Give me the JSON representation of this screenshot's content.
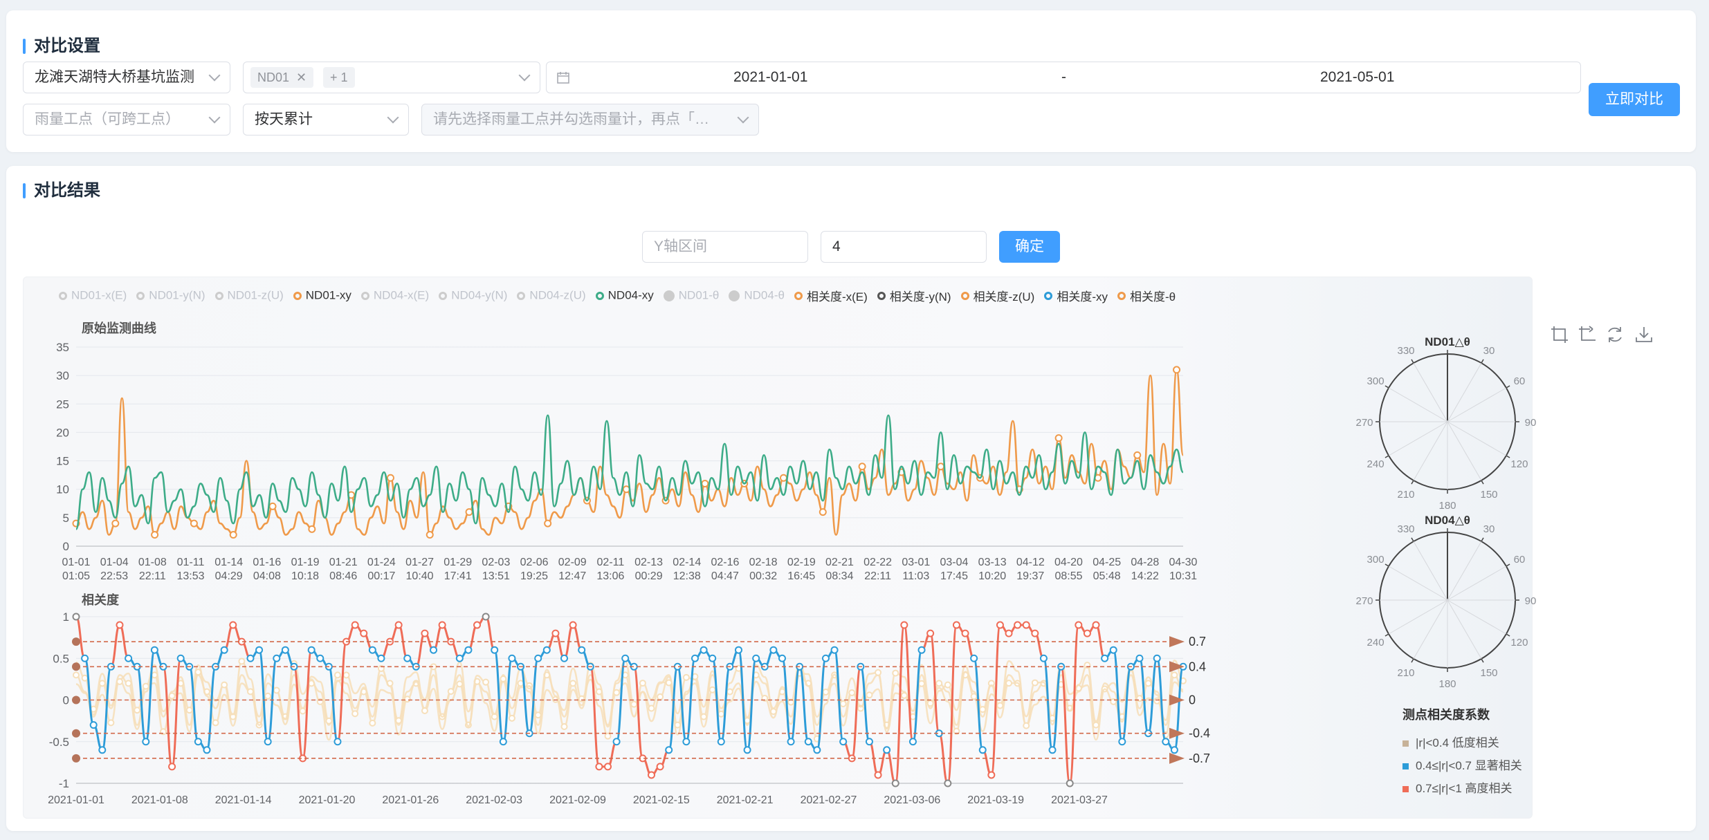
{
  "settings": {
    "title": "对比设置",
    "project": "龙滩天湖特大桥基坑监测",
    "point_tag": "ND01",
    "point_more": "+ 1",
    "date_start": "2021-01-01",
    "date_sep": "-",
    "date_end": "2021-05-01",
    "rain_placeholder": "雨量工点（可跨工点）",
    "accum": "按天累计",
    "rain_gauge_placeholder": "请先选择雨量工点并勾选雨量计，再点「…",
    "compare_button": "立即对比"
  },
  "results": {
    "title": "对比结果",
    "y_range_placeholder": "Y轴区间",
    "y_range_value": "4",
    "confirm_button": "确定"
  },
  "legend": [
    {
      "label": "ND01-x(E)",
      "color": "#cccccc",
      "kind": "ring",
      "active": false
    },
    {
      "label": "ND01-y(N)",
      "color": "#cccccc",
      "kind": "ring",
      "active": false
    },
    {
      "label": "ND01-z(U)",
      "color": "#cccccc",
      "kind": "ring",
      "active": false
    },
    {
      "label": "ND01-xy",
      "color": "#ef9a4a",
      "kind": "ring",
      "active": true
    },
    {
      "label": "ND04-x(E)",
      "color": "#cccccc",
      "kind": "ring",
      "active": false
    },
    {
      "label": "ND04-y(N)",
      "color": "#cccccc",
      "kind": "ring",
      "active": false
    },
    {
      "label": "ND04-z(U)",
      "color": "#cccccc",
      "kind": "ring",
      "active": false
    },
    {
      "label": "ND04-xy",
      "color": "#3dac88",
      "kind": "ring",
      "active": true
    },
    {
      "label": "ND01-θ",
      "color": "#cccccc",
      "kind": "dot",
      "active": false
    },
    {
      "label": "ND04-θ",
      "color": "#cccccc",
      "kind": "dot",
      "active": false
    },
    {
      "label": "相关度-x(E)",
      "color": "#ef9a4a",
      "kind": "ring",
      "active": true
    },
    {
      "label": "相关度-y(N)",
      "color": "#555555",
      "kind": "ring",
      "active": true
    },
    {
      "label": "相关度-z(U)",
      "color": "#ef9a4a",
      "kind": "ring",
      "active": true
    },
    {
      "label": "相关度-xy",
      "color": "#2d9cd8",
      "kind": "ring",
      "active": true
    },
    {
      "label": "相关度-θ",
      "color": "#ef9a4a",
      "kind": "ring",
      "active": true
    }
  ],
  "colors": {
    "nd01": "#ef9a4a",
    "nd04": "#3dac88",
    "corr_mid": "#2d9cd8",
    "corr_high": "#ef6c57",
    "corr_low": "#f6dfba",
    "ref": "#d2694a"
  },
  "chart_data": [
    {
      "type": "line",
      "title": "原始监测曲线",
      "ylim": [
        0,
        35
      ],
      "yticks": [
        "0",
        "5",
        "10",
        "15",
        "20",
        "25",
        "30",
        "35"
      ],
      "xticks": [
        [
          "01-01",
          "01:05"
        ],
        [
          "01-04",
          "22:53"
        ],
        [
          "01-08",
          "22:11"
        ],
        [
          "01-11",
          "13:53"
        ],
        [
          "01-14",
          "04:29"
        ],
        [
          "01-16",
          "04:08"
        ],
        [
          "01-19",
          "10:18"
        ],
        [
          "01-21",
          "08:46"
        ],
        [
          "01-24",
          "00:17"
        ],
        [
          "01-27",
          "10:40"
        ],
        [
          "01-29",
          "17:41"
        ],
        [
          "02-03",
          "13:51"
        ],
        [
          "02-06",
          "19:25"
        ],
        [
          "02-09",
          "12:47"
        ],
        [
          "02-11",
          "13:06"
        ],
        [
          "02-13",
          "00:29"
        ],
        [
          "02-14",
          "12:38"
        ],
        [
          "02-16",
          "04:47"
        ],
        [
          "02-18",
          "00:32"
        ],
        [
          "02-19",
          "16:45"
        ],
        [
          "02-21",
          "08:34"
        ],
        [
          "02-22",
          "22:11"
        ],
        [
          "03-01",
          "11:03"
        ],
        [
          "03-04",
          "17:45"
        ],
        [
          "03-13",
          "10:20"
        ],
        [
          "04-12",
          "19:37"
        ],
        [
          "04-20",
          "08:55"
        ],
        [
          "04-25",
          "05:48"
        ],
        [
          "04-28",
          "14:22"
        ],
        [
          "04-30",
          "10:31"
        ]
      ],
      "series": [
        {
          "name": "ND01-xy",
          "values": [
            4,
            6,
            3,
            5,
            8,
            2,
            4,
            26,
            6,
            3,
            5,
            7,
            2,
            4,
            6,
            3,
            7,
            5,
            4,
            3,
            6,
            8,
            4,
            3,
            2,
            5,
            15,
            6,
            3,
            4,
            7,
            5,
            2,
            3,
            6,
            4,
            3,
            8,
            5,
            2,
            4,
            6,
            9,
            3,
            2,
            5,
            7,
            4,
            12,
            6,
            3,
            8,
            5,
            13,
            2,
            4,
            7,
            5,
            3,
            4,
            6,
            8,
            3,
            2,
            5,
            4,
            7,
            6,
            3,
            5,
            8,
            10,
            4,
            6,
            5,
            7,
            9,
            12,
            8,
            6,
            14,
            9,
            7,
            5,
            10,
            8,
            11,
            6,
            9,
            12,
            8,
            10,
            7,
            13,
            9,
            6,
            11,
            8,
            10,
            7,
            12,
            9,
            11,
            8,
            14,
            10,
            7,
            9,
            12,
            11,
            8,
            10,
            13,
            9,
            6,
            12,
            2,
            9,
            11,
            8,
            14,
            10,
            12,
            17,
            9,
            11,
            13,
            8,
            10,
            15,
            12,
            9,
            14,
            11,
            10,
            13,
            8,
            16,
            12,
            11,
            14,
            9,
            13,
            22,
            10,
            12,
            17,
            11,
            14,
            10,
            19,
            12,
            16,
            13,
            11,
            18,
            12,
            15,
            10,
            17,
            14,
            12,
            16,
            13,
            30,
            9,
            18,
            11,
            31,
            16
          ]
        },
        {
          "name": "ND04-xy",
          "values": [
            3,
            10,
            13,
            6,
            12,
            8,
            5,
            11,
            14,
            7,
            9,
            4,
            12,
            13,
            6,
            8,
            10,
            5,
            7,
            11,
            9,
            6,
            12,
            8,
            4,
            10,
            13,
            7,
            9,
            5,
            11,
            8,
            6,
            12,
            10,
            7,
            13,
            9,
            5,
            11,
            8,
            14,
            6,
            10,
            12,
            7,
            9,
            13,
            8,
            11,
            5,
            10,
            12,
            7,
            9,
            14,
            6,
            11,
            8,
            13,
            10,
            4,
            12,
            9,
            7,
            11,
            6,
            14,
            10,
            8,
            13,
            9,
            23,
            7,
            11,
            15,
            9,
            12,
            8,
            14,
            10,
            22,
            12,
            9,
            13,
            7,
            16,
            11,
            10,
            14,
            8,
            12,
            9,
            15,
            11,
            13,
            7,
            12,
            10,
            18,
            9,
            14,
            11,
            13,
            8,
            16,
            10,
            12,
            9,
            14,
            11,
            15,
            10,
            13,
            8,
            17,
            12,
            10,
            14,
            11,
            13,
            9,
            16,
            12,
            23,
            10,
            14,
            11,
            15,
            9,
            13,
            12,
            20,
            10,
            16,
            11,
            14,
            13,
            12,
            17,
            10,
            15,
            11,
            13,
            9,
            14,
            12,
            16,
            10,
            13,
            18,
            11,
            15,
            12,
            20,
            10,
            14,
            13,
            9,
            17,
            11,
            12,
            15,
            10,
            16,
            13,
            11,
            14,
            17,
            13
          ]
        }
      ]
    },
    {
      "type": "line",
      "title": "相关度",
      "ylim": [
        -1,
        1
      ],
      "yticks": [
        "-1",
        "-0.5",
        "0",
        "0.5",
        "1"
      ],
      "xticks": [
        "2021-01-01",
        "2021-01-08",
        "2021-01-14",
        "2021-01-20",
        "2021-01-26",
        "2021-02-03",
        "2021-02-09",
        "2021-02-15",
        "2021-02-21",
        "2021-02-27",
        "2021-03-06",
        "2021-03-19",
        "2021-03-27"
      ],
      "reference_lines": [
        {
          "value": 0.7,
          "label": "0.7"
        },
        {
          "value": 0.4,
          "label": "0.4"
        },
        {
          "value": 0,
          "label": "0"
        },
        {
          "value": -0.4,
          "label": "-0.4"
        },
        {
          "value": -0.7,
          "label": "-0.7"
        }
      ],
      "series": [
        {
          "name": "相关度-xy",
          "values": [
            1,
            0.5,
            -0.3,
            -0.6,
            0.4,
            0.9,
            0.5,
            0.4,
            -0.5,
            0.6,
            0.4,
            -0.8,
            0.5,
            0.4,
            -0.5,
            -0.6,
            0.4,
            0.6,
            0.9,
            0.7,
            0.5,
            0.6,
            -0.5,
            0.5,
            0.6,
            0.4,
            -0.7,
            0.6,
            0.5,
            0.4,
            -0.5,
            0.7,
            0.9,
            0.8,
            0.6,
            0.5,
            0.7,
            0.9,
            0.5,
            0.4,
            0.8,
            0.6,
            0.9,
            0.7,
            0.5,
            0.6,
            0.9,
            1,
            0.6,
            -0.5,
            0.5,
            0.4,
            -0.4,
            0.5,
            0.6,
            0.8,
            0.5,
            0.9,
            0.6,
            0.4,
            -0.8,
            -0.8,
            -0.5,
            0.5,
            0.4,
            -0.7,
            -0.9,
            -0.8,
            -0.6,
            0.4,
            -0.5,
            0.5,
            0.6,
            0.5,
            -0.5,
            0.4,
            0.6,
            -0.6,
            0.5,
            0.4,
            0.6,
            0.5,
            -0.5,
            0.4,
            -0.5,
            -0.6,
            0.5,
            0.6,
            -0.5,
            -0.7,
            0.4,
            -0.5,
            -0.9,
            -0.6,
            -1,
            0.9,
            -0.5,
            0.6,
            0.8,
            -0.4,
            -1,
            0.9,
            0.8,
            0.5,
            -0.6,
            -0.9,
            0.9,
            0.8,
            0.9,
            0.9,
            0.8,
            0.5,
            -0.6,
            0.4,
            -1,
            0.9,
            0.8,
            0.9,
            0.5,
            0.6,
            -0.5,
            0.4,
            0.5,
            -0.4,
            0.5,
            -0.5,
            -0.6,
            0.4
          ]
        },
        {
          "name": "相关度-x(E)",
          "values": [
            0.3,
            0.1,
            -0.2,
            0.2,
            -0.1,
            0.3,
            0.2,
            -0.3,
            0.1,
            0.3,
            -0.2,
            0.1,
            0.2,
            -0.3,
            0.3,
            0.1,
            -0.1,
            0.2,
            -0.2,
            0.3,
            0.1,
            -0.3,
            0.2,
            0.1,
            -0.2,
            0.3,
            -0.1,
            0.2,
            0.1,
            -0.3,
            0.3,
            0.2,
            -0.1,
            0.1,
            -0.2,
            0.3,
            0.2,
            -0.3,
            0.1,
            0.2,
            -0.1,
            0.3,
            -0.2,
            0.1,
            0.3,
            -0.3,
            0.2,
            0.1,
            -0.2,
            0.3,
            -0.1,
            0.2,
            0.1,
            -0.3,
            0.3,
            0.1,
            -0.2,
            0.2,
            -0.1,
            0.3,
            0.1,
            -0.3,
            0.2,
            0.3,
            -0.2,
            0.1,
            -0.1,
            0.2,
            0.3,
            -0.3,
            0.1,
            0.2,
            -0.2,
            0.3,
            -0.1,
            0.1,
            0.2,
            -0.3,
            0.3,
            0.2,
            -0.1,
            0.1,
            -0.2,
            0.3,
            0.2,
            -0.3,
            0.1,
            0.3,
            -0.2,
            0.1,
            -0.1,
            0.2,
            0.3,
            -0.3,
            0.2,
            0.1,
            -0.2,
            0.3,
            -0.1,
            0.2,
            0.1,
            -0.3,
            0.3,
            0.1,
            -0.2,
            0.2,
            -0.1,
            0.3,
            0.2,
            -0.3,
            0.1,
            0.2,
            -0.2,
            0.3,
            -0.1,
            0.1,
            0.3,
            -0.3,
            0.2,
            0.1,
            -0.2,
            0.3,
            -0.1,
            0.2,
            0.1,
            -0.3,
            0.3,
            0.1
          ]
        }
      ]
    },
    {
      "type": "polar",
      "title": "ND01△θ",
      "angle_ticks": [
        "330",
        "30",
        "60",
        "300",
        "270",
        "90",
        "240",
        "120",
        "210",
        "150",
        "180"
      ]
    },
    {
      "type": "polar",
      "title": "ND04△θ",
      "angle_ticks": [
        "330",
        "30",
        "60",
        "300",
        "270",
        "90",
        "240",
        "120",
        "210",
        "150",
        "180"
      ]
    }
  ],
  "corr_legend": {
    "title": "测点相关度系数",
    "items": [
      {
        "color": "#c7b299",
        "label": "|r|<0.4  低度相关"
      },
      {
        "color": "#2d9cd8",
        "label": "0.4≤|r|<0.7  显著相关"
      },
      {
        "color": "#ef6c57",
        "label": "0.7≤|r|<1  高度相关"
      }
    ]
  }
}
